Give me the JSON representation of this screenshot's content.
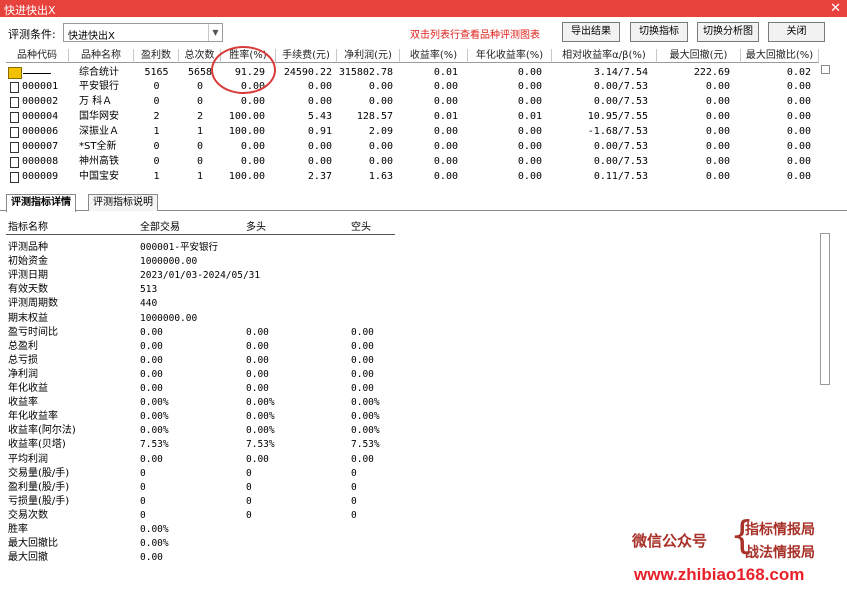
{
  "window": {
    "title": "快进快出X",
    "close_icon": "✕"
  },
  "toolbar": {
    "condition_label": "评测条件:",
    "condition_value": "快进快出X",
    "hint": "双击列表行查看品种评测图表",
    "export_label": "导出结果",
    "switch_indicator_label": "切换指标",
    "switch_analysis_label": "切换分析图",
    "close_label": "关闭"
  },
  "grid": {
    "headers": [
      "品种代码",
      "品种名称",
      "盈利数",
      "总次数",
      "胜率(%)",
      "手续费(元)",
      "净利润(元)",
      "收益率(%)",
      "年化收益率(%)",
      "相对收益率α/β(%)",
      "最大回撤(元)",
      "最大回撤比(%)"
    ],
    "summary": {
      "code": "",
      "name": "综合统计",
      "profit_count": "5165",
      "total_count": "5658",
      "win_rate": "91.29",
      "fee": "24590.22",
      "net_profit": "315802.78",
      "return": "0.01",
      "annual_return": "0.00",
      "relative": "3.14/7.54",
      "max_dd": "222.69",
      "max_dd_ratio": "0.02"
    },
    "rows": [
      {
        "code": "000001",
        "name": "平安银行",
        "profit_count": "0",
        "total_count": "0",
        "win_rate": "0.00",
        "fee": "0.00",
        "net_profit": "0.00",
        "return": "0.00",
        "annual_return": "0.00",
        "relative": "0.00/7.53",
        "max_dd": "0.00",
        "max_dd_ratio": "0.00"
      },
      {
        "code": "000002",
        "name": "万 科Ａ",
        "profit_count": "0",
        "total_count": "0",
        "win_rate": "0.00",
        "fee": "0.00",
        "net_profit": "0.00",
        "return": "0.00",
        "annual_return": "0.00",
        "relative": "0.00/7.53",
        "max_dd": "0.00",
        "max_dd_ratio": "0.00"
      },
      {
        "code": "000004",
        "name": "国华网安",
        "profit_count": "2",
        "total_count": "2",
        "win_rate": "100.00",
        "fee": "5.43",
        "net_profit": "128.57",
        "return": "0.01",
        "annual_return": "0.01",
        "relative": "10.95/7.55",
        "max_dd": "0.00",
        "max_dd_ratio": "0.00"
      },
      {
        "code": "000006",
        "name": "深振业Ａ",
        "profit_count": "1",
        "total_count": "1",
        "win_rate": "100.00",
        "fee": "0.91",
        "net_profit": "2.09",
        "return": "0.00",
        "annual_return": "0.00",
        "relative": "-1.68/7.53",
        "max_dd": "0.00",
        "max_dd_ratio": "0.00"
      },
      {
        "code": "000007",
        "name": "*ST全新",
        "profit_count": "0",
        "total_count": "0",
        "win_rate": "0.00",
        "fee": "0.00",
        "net_profit": "0.00",
        "return": "0.00",
        "annual_return": "0.00",
        "relative": "0.00/7.53",
        "max_dd": "0.00",
        "max_dd_ratio": "0.00"
      },
      {
        "code": "000008",
        "name": "神州高铁",
        "profit_count": "0",
        "total_count": "0",
        "win_rate": "0.00",
        "fee": "0.00",
        "net_profit": "0.00",
        "return": "0.00",
        "annual_return": "0.00",
        "relative": "0.00/7.53",
        "max_dd": "0.00",
        "max_dd_ratio": "0.00"
      },
      {
        "code": "000009",
        "name": "中国宝安",
        "profit_count": "1",
        "total_count": "1",
        "win_rate": "100.00",
        "fee": "2.37",
        "net_profit": "1.63",
        "return": "0.00",
        "annual_return": "0.00",
        "relative": "0.11/7.53",
        "max_dd": "0.00",
        "max_dd_ratio": "0.00"
      }
    ]
  },
  "tabs": [
    {
      "label": "评测指标详情",
      "active": true
    },
    {
      "label": "评测指标说明",
      "active": false
    }
  ],
  "detail": {
    "headers": {
      "name": "指标名称",
      "all": "全部交易",
      "long": "多头",
      "short": "空头"
    },
    "rows": [
      {
        "label": "评测品种",
        "all": "000001-平安银行",
        "long": "",
        "short": ""
      },
      {
        "label": "初始资金",
        "all": "1000000.00",
        "long": "",
        "short": ""
      },
      {
        "label": "评测日期",
        "all": "2023/01/03-2024/05/31",
        "long": "",
        "short": ""
      },
      {
        "label": "有效天数",
        "all": "513",
        "long": "",
        "short": ""
      },
      {
        "label": "评测周期数",
        "all": "440",
        "long": "",
        "short": ""
      },
      {
        "label": "期末权益",
        "all": "1000000.00",
        "long": "",
        "short": ""
      },
      {
        "label": "盈亏时间比",
        "all": "0.00",
        "long": "0.00",
        "short": "0.00"
      },
      {
        "label": "总盈利",
        "all": "0.00",
        "long": "0.00",
        "short": "0.00"
      },
      {
        "label": "总亏损",
        "all": "0.00",
        "long": "0.00",
        "short": "0.00"
      },
      {
        "label": "净利润",
        "all": "0.00",
        "long": "0.00",
        "short": "0.00"
      },
      {
        "label": "年化收益",
        "all": "0.00",
        "long": "0.00",
        "short": "0.00"
      },
      {
        "label": "收益率",
        "all": "0.00%",
        "long": "0.00%",
        "short": "0.00%"
      },
      {
        "label": "年化收益率",
        "all": "0.00%",
        "long": "0.00%",
        "short": "0.00%"
      },
      {
        "label": "收益率(阿尔法)",
        "all": "0.00%",
        "long": "0.00%",
        "short": "0.00%"
      },
      {
        "label": "收益率(贝塔)",
        "all": "7.53%",
        "long": "7.53%",
        "short": "7.53%"
      },
      {
        "label": "平均利润",
        "all": "0.00",
        "long": "0.00",
        "short": "0.00"
      },
      {
        "label": "交易量(股/手)",
        "all": "0",
        "long": "0",
        "short": "0"
      },
      {
        "label": "盈利量(股/手)",
        "all": "0",
        "long": "0",
        "short": "0"
      },
      {
        "label": "亏损量(股/手)",
        "all": "0",
        "long": "0",
        "short": "0"
      },
      {
        "label": "交易次数",
        "all": "0",
        "long": "0",
        "short": "0"
      },
      {
        "label": "胜率",
        "all": "0.00%",
        "long": "",
        "short": ""
      },
      {
        "label": "最大回撤比",
        "all": "0.00%",
        "long": "",
        "short": ""
      },
      {
        "label": "最大回撤",
        "all": "0.00",
        "long": "",
        "short": ""
      }
    ]
  },
  "watermark": {
    "wechat": "微信公众号",
    "line1": "指标情报局",
    "line2": "战法情报局",
    "url": "www.zhibiao168.com",
    "color": "#a8322a"
  },
  "colors": {
    "title_bar": "#e8423c",
    "hint": "#e0201b",
    "highlight_circle": "#d83a3a"
  }
}
